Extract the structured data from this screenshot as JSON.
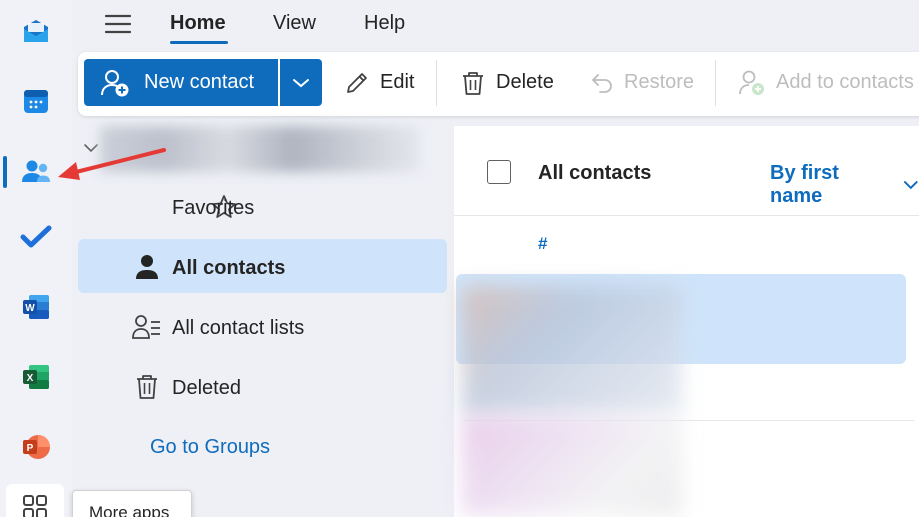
{
  "menu": {
    "tabs": [
      {
        "label": "Home",
        "active": true
      },
      {
        "label": "View",
        "active": false
      },
      {
        "label": "Help",
        "active": false
      }
    ]
  },
  "toolbar": {
    "new_contact_label": "New contact",
    "edit_label": "Edit",
    "delete_label": "Delete",
    "restore_label": "Restore",
    "add_to_contacts_label": "Add to contacts"
  },
  "folders": {
    "items": [
      {
        "label": "Favorites",
        "icon": "star-icon",
        "active": false
      },
      {
        "label": "All contacts",
        "icon": "person-icon",
        "active": true
      },
      {
        "label": "All contact lists",
        "icon": "contact-list-icon",
        "active": false
      },
      {
        "label": "Deleted",
        "icon": "trash-icon",
        "active": false
      }
    ],
    "goto_groups_label": "Go to Groups"
  },
  "list": {
    "title": "All contacts",
    "sort_label": "By first name",
    "group_header": "#"
  },
  "rail": {
    "apps": [
      "mail-icon",
      "calendar-icon",
      "people-icon",
      "todo-icon",
      "word-icon",
      "excel-icon",
      "powerpoint-icon",
      "more-apps-icon"
    ],
    "more_apps_tooltip": "More apps"
  },
  "colors": {
    "accent": "#0f6cbd",
    "selected_bg": "#cfe4fa",
    "annotation": "#e53935"
  }
}
